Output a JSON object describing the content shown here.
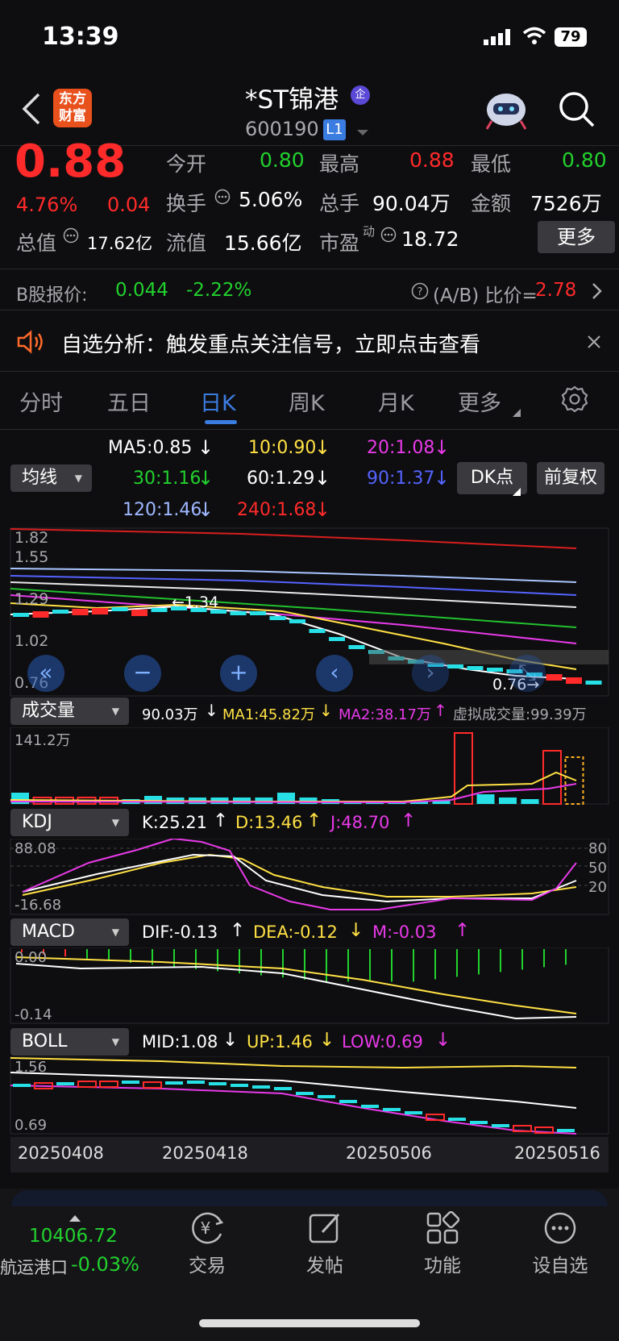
{
  "status_bar": {
    "time": "13:39",
    "battery": "79"
  },
  "header": {
    "logo_line1": "东方",
    "logo_line2": "财富",
    "title": "*ST锦港",
    "enterprise_badge": "企",
    "code": "600190",
    "level_badge": "L1"
  },
  "quote": {
    "price": "0.88",
    "change_pct": "4.76%",
    "change": "0.04",
    "open_label": "今开",
    "open": "0.80",
    "high_label": "最高",
    "high": "0.88",
    "low_label": "最低",
    "low": "0.80",
    "turnover_label": "换手",
    "turnover": "5.06%",
    "volume_label": "总手",
    "volume": "90.04万",
    "amount_label": "金额",
    "amount": "7526万",
    "mktcap_label": "总值",
    "mktcap": "17.62亿",
    "float_label": "流值",
    "float_cap": "15.66亿",
    "pe_label": "市盈",
    "pe_sup": "动",
    "pe": "18.72",
    "more_button": "更多"
  },
  "b_share": {
    "label": "B股报价:",
    "price": "0.044",
    "pct": "-2.22%",
    "ratio_label": "(A/B) 比价=",
    "ratio": "2.78"
  },
  "alert": {
    "text": "自选分析：触发重点关注信号，立即点击查看"
  },
  "tabs": [
    "分时",
    "五日",
    "日K",
    "周K",
    "月K",
    "更多"
  ],
  "active_tab": "日K",
  "ma": {
    "dropdown": "均线",
    "ma5": "MA5:0.85",
    "ma10": "10:0.90",
    "ma20": "20:1.08",
    "ma30": "30:1.16",
    "ma60": "60:1.29",
    "ma90": "90:1.37",
    "ma120": "120:1.46",
    "ma240": "240:1.68",
    "dk_button": "DK点",
    "fq_button": "前复权"
  },
  "kline": {
    "y_top": "1.82",
    "y_2": "1.55",
    "y_3": "1.29",
    "y_4": "1.02",
    "y_bottom": "0.76",
    "hi_mark": "1.34",
    "lo_mark": "0.76"
  },
  "volume": {
    "dropdown": "成交量",
    "vol": "90.03万",
    "ma1": "MA1:45.82万",
    "ma2": "MA2:38.17万",
    "virtual": "虚拟成交量:99.39万",
    "y_max": "141.2万"
  },
  "kdj": {
    "dropdown": "KDJ",
    "k": "K:25.21",
    "d": "D:13.46",
    "j": "J:48.70",
    "y_top": "88.08",
    "y_bottom": "-16.68",
    "r80": "80",
    "r50": "50",
    "r20": "20"
  },
  "macd": {
    "dropdown": "MACD",
    "dif": "DIF:-0.13",
    "dea": "DEA:-0.12",
    "m": "M:-0.03",
    "y_top": "0.00",
    "y_bottom": "-0.14"
  },
  "boll": {
    "dropdown": "BOLL",
    "mid": "MID:1.08",
    "up": "UP:1.46",
    "low": "LOW:0.69",
    "y_top": "1.56",
    "y_bottom": "0.69"
  },
  "dates": [
    "20250408",
    "20250418",
    "20250506",
    "20250516"
  ],
  "bottom": {
    "index_value": "10406.72",
    "index_name": "航运港口",
    "index_pct": "-0.03%",
    "nav": [
      "交易",
      "发帖",
      "功能",
      "设自选"
    ]
  },
  "colors": {
    "up": "#ff2a2a",
    "down": "#22d12e",
    "accent": "#3b7ce0"
  }
}
